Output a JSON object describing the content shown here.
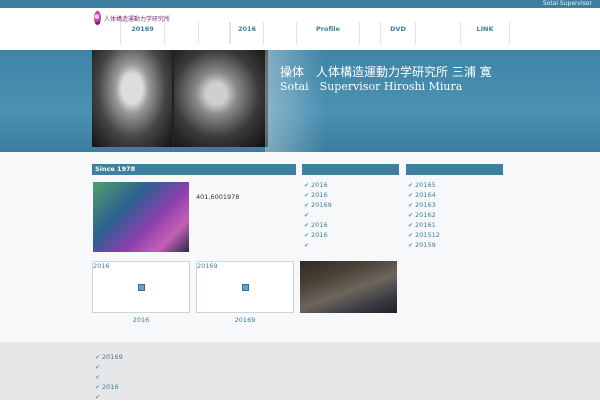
{
  "topbar": {
    "right_text": "Sotai Supervisor"
  },
  "logo": {
    "text": "人体構造運動力学研究所"
  },
  "nav": {
    "items": [
      "20169",
      "",
      "2016",
      "Profile",
      "DVD",
      "LINK"
    ]
  },
  "hero": {
    "title_jp": "操体　人体構造運動力学研究所 三浦 寛",
    "title_en": "Sotai　Supervisor Hiroshi Miura"
  },
  "section": {
    "since": "Since 1978",
    "thumb_caption": "401,6001978",
    "col2_items": [
      "2016",
      "2016",
      "20169",
      "",
      "2016",
      "2016",
      ""
    ],
    "col3_items": [
      "20165",
      "20164",
      "20163",
      "20162",
      "20161",
      "201512",
      "20159"
    ],
    "box1_label": "2016",
    "box2_label": "20169",
    "box1_caption": "2016",
    "box2_caption": "20169"
  },
  "footer": {
    "items": [
      "20169",
      "",
      "",
      "2016",
      ""
    ]
  },
  "colors": {
    "accent": "#3f7f9f",
    "hero_bg": "#4c91b2"
  }
}
